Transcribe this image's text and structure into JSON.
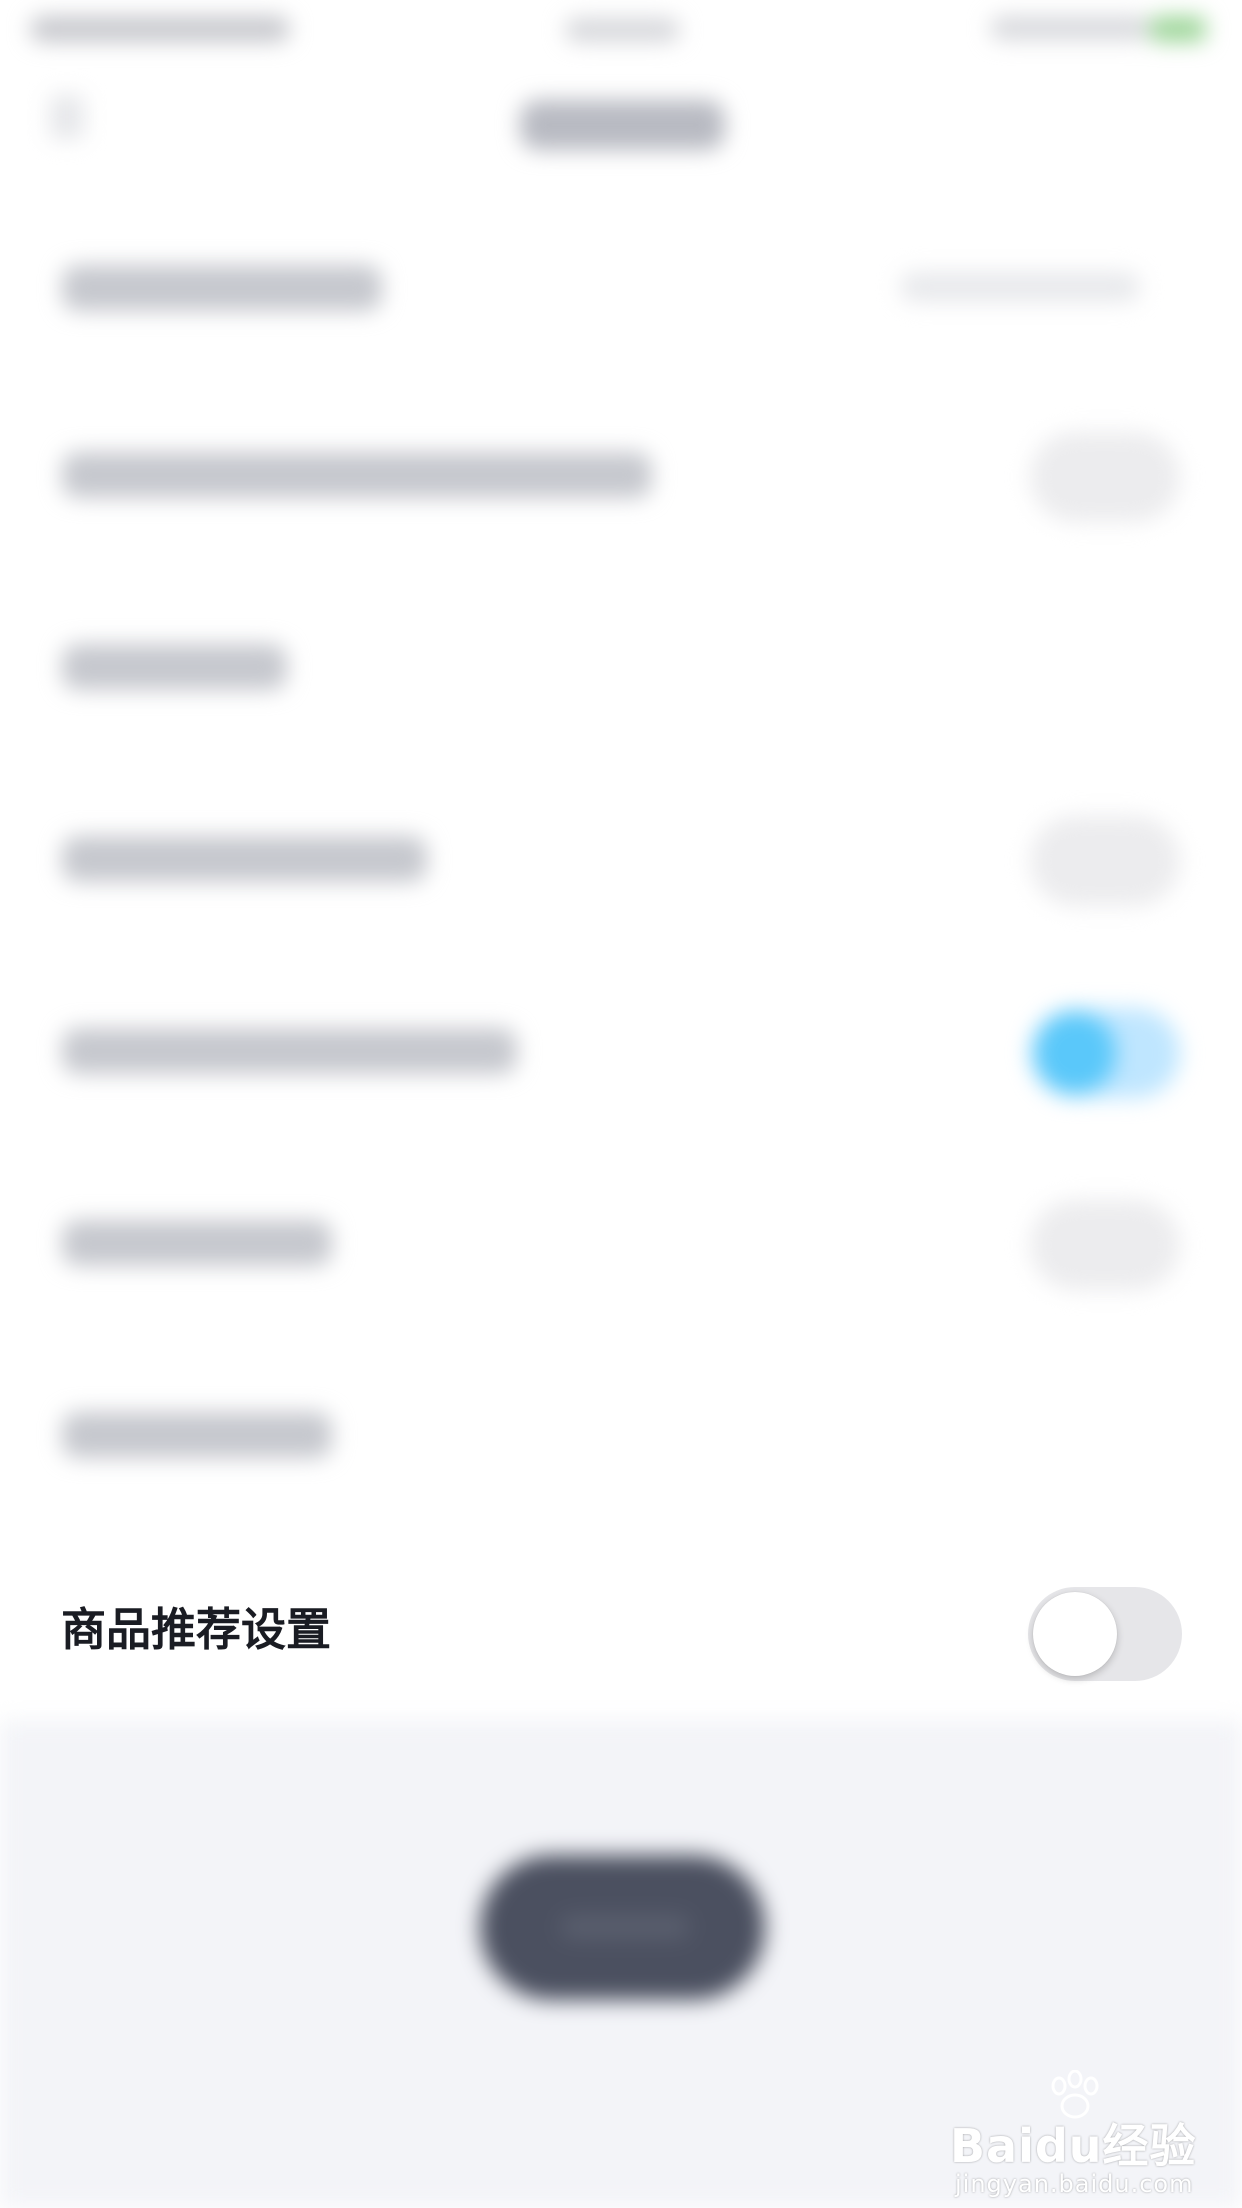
{
  "settings": {
    "row": {
      "label": "商品推荐设置",
      "toggle_on": false
    }
  },
  "colors": {
    "toggle_off_track": "#e6e6e9",
    "toggle_knob": "#ffffff",
    "accent_blue": "#5ac8fa",
    "label_text": "#1a1c23",
    "bottom_background": "#f3f4f8",
    "bottom_button": "#4b5060"
  },
  "watermark": {
    "brand": "Baidu经验",
    "url": "jingyan.baidu.com"
  }
}
